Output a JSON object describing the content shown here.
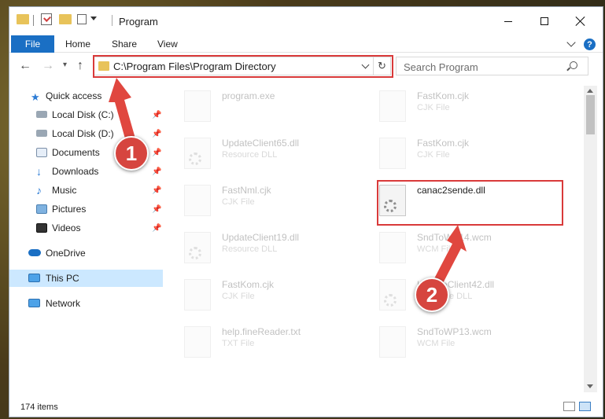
{
  "window": {
    "title": "Program",
    "min_glyph": "",
    "max_glyph": "",
    "close_glyph": ""
  },
  "ribbon": {
    "tabs": [
      "File",
      "Home",
      "Share",
      "View"
    ],
    "help": "?"
  },
  "nav": {
    "back": "←",
    "forward": "→",
    "recent": "▾",
    "up": "↑",
    "address": "C:\\Program Files\\Program Directory",
    "refresh": "↻",
    "search_placeholder": "Search Program"
  },
  "sidebar": {
    "items": [
      {
        "label": "Quick access",
        "icon": "star-icon"
      },
      {
        "label": "Local Disk (C:)",
        "icon": "drive-icon",
        "pinned": true
      },
      {
        "label": "Local Disk (D:)",
        "icon": "drive-icon",
        "pinned": true
      },
      {
        "label": "Documents",
        "icon": "documents-icon",
        "pinned": true
      },
      {
        "label": "Downloads",
        "icon": "downloads-icon",
        "pinned": true
      },
      {
        "label": "Music",
        "icon": "music-icon",
        "pinned": true
      },
      {
        "label": "Pictures",
        "icon": "pictures-icon",
        "pinned": true
      },
      {
        "label": "Videos",
        "icon": "videos-icon",
        "pinned": true
      },
      {
        "label": "OneDrive",
        "icon": "cloud-icon"
      },
      {
        "label": "This PC",
        "icon": "computer-icon",
        "selected": true
      },
      {
        "label": "Network",
        "icon": "network-icon"
      }
    ],
    "pin_glyph": "📌"
  },
  "files": [
    {
      "name": "program.exe",
      "type": ""
    },
    {
      "name": "FastKom.cjk",
      "type": "CJK File"
    },
    {
      "name": "UpdateClient65.dll",
      "type": "Resource DLL"
    },
    {
      "name": "FastKom.cjk",
      "type": "CJK File"
    },
    {
      "name": "FastNml.cjk",
      "type": "CJK File"
    },
    {
      "name": "canac2sende.dll",
      "type": ""
    },
    {
      "name": "UpdateClient19.dll",
      "type": "Resource DLL"
    },
    {
      "name": "SndToWP14.wcm",
      "type": "WCM File"
    },
    {
      "name": "FastKom.cjk",
      "type": "CJK File"
    },
    {
      "name": "UpdateClient42.dll",
      "type": "Resource DLL"
    },
    {
      "name": "help.fineReader.txt",
      "type": "TXT File"
    },
    {
      "name": "SndToWP13.wcm",
      "type": "WCM File"
    }
  ],
  "status": {
    "count": "174 items"
  },
  "annotations": {
    "step1": "1",
    "step2": "2"
  },
  "colors": {
    "accent": "#1a6fc4",
    "highlight": "#d93a3a",
    "selected": "#cce8ff"
  }
}
